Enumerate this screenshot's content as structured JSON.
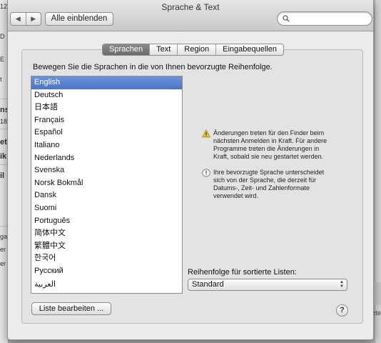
{
  "window": {
    "title": "Sprache & Text"
  },
  "toolbar": {
    "back_glyph": "◀",
    "forward_glyph": "▶",
    "show_all_label": "Alle einblenden",
    "search_value": "",
    "search_placeholder": ""
  },
  "tabs": [
    {
      "label": "Sprachen",
      "active": true
    },
    {
      "label": "Text",
      "active": false
    },
    {
      "label": "Region",
      "active": false
    },
    {
      "label": "Eingabequellen",
      "active": false
    }
  ],
  "languages": {
    "instruction": "Bewegen Sie die Sprachen in die von Ihnen bevorzugte Reihenfolge.",
    "items": [
      "English",
      "Deutsch",
      "日本語",
      "Français",
      "Español",
      "Italiano",
      "Nederlands",
      "Svenska",
      "Norsk Bokmål",
      "Dansk",
      "Suomi",
      "Português",
      "简体中文",
      "繁體中文",
      "한국어",
      "Русский",
      "العربية"
    ],
    "selected_index": 0
  },
  "notices": {
    "restart_lines": [
      "Änderungen treten für den Finder beim",
      "nächsten Anmelden in Kraft. Für andere",
      "Programme treten die Änderungen in",
      "Kraft, sobald sie neu gestartet werden."
    ],
    "format_lines": [
      "Ihre bevorzugte Sprache unterscheidet",
      "sich von der Sprache, die derzeit für",
      "Datums-, Zeit- und Zahlenformate",
      "verwendet wird."
    ]
  },
  "sort": {
    "label": "Reihenfolge für sortierte Listen:",
    "selected": "Standard"
  },
  "buttons": {
    "edit_list": "Liste bearbeiten ...",
    "help": "?"
  },
  "background": {
    "fragments": [
      "12",
      "D",
      "E",
      "t",
      "ns",
      "18",
      "et",
      "ik",
      "il",
      "ga",
      "er",
      "er",
      "itzte"
    ]
  },
  "colors": {
    "selection": "#4a75c7",
    "window_bg": "#ececec",
    "content_bg": "#e3e3e3",
    "active_tab": "#7a7a7a"
  }
}
